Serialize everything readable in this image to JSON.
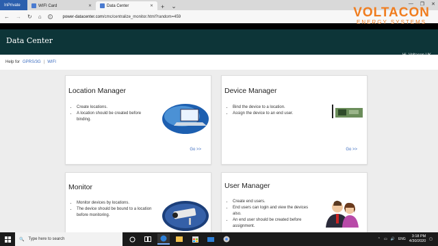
{
  "browser": {
    "tabs": [
      {
        "label": "InPrivate"
      },
      {
        "label": "WIFI Card"
      },
      {
        "label": "Data Center"
      }
    ],
    "address": {
      "host": "power-datacenter.com",
      "path": "/cmc/centralize_monitor.html?random=459"
    }
  },
  "header": {
    "title": "Data Center",
    "greeting": "Hi,  Voltacon UK"
  },
  "logo": {
    "name": "VOLTACON",
    "tagline": "ENERGY SYSTEMS"
  },
  "help": {
    "prefix": "Help for",
    "links": [
      "GPRS/3G",
      "WIFI"
    ]
  },
  "cards": {
    "location": {
      "title": "Location Manager",
      "items": [
        "Create locations.",
        "A location should be created before binding."
      ],
      "go": "Go >>"
    },
    "device": {
      "title": "Device Manager",
      "items": [
        "Bind the device to a location.",
        "Assign the device to an end user."
      ],
      "go": "Go >>"
    },
    "monitor": {
      "title": "Monitor",
      "items": [
        "Monitor devices by locations.",
        "The device should be bound to a location before monitoring."
      ]
    },
    "user": {
      "title": "User Manager",
      "items": [
        "Create end users.",
        "End users can login and view the devices also.",
        "An end user should be created before assignment."
      ]
    }
  },
  "taskbar": {
    "search_placeholder": "Type here to search",
    "lang": "ENG",
    "time": "3:18 PM",
    "date": "4/30/2020"
  },
  "colors": {
    "header_bg": "#0d3538",
    "logo": "#f07d1f",
    "link": "#3a6bbf"
  }
}
